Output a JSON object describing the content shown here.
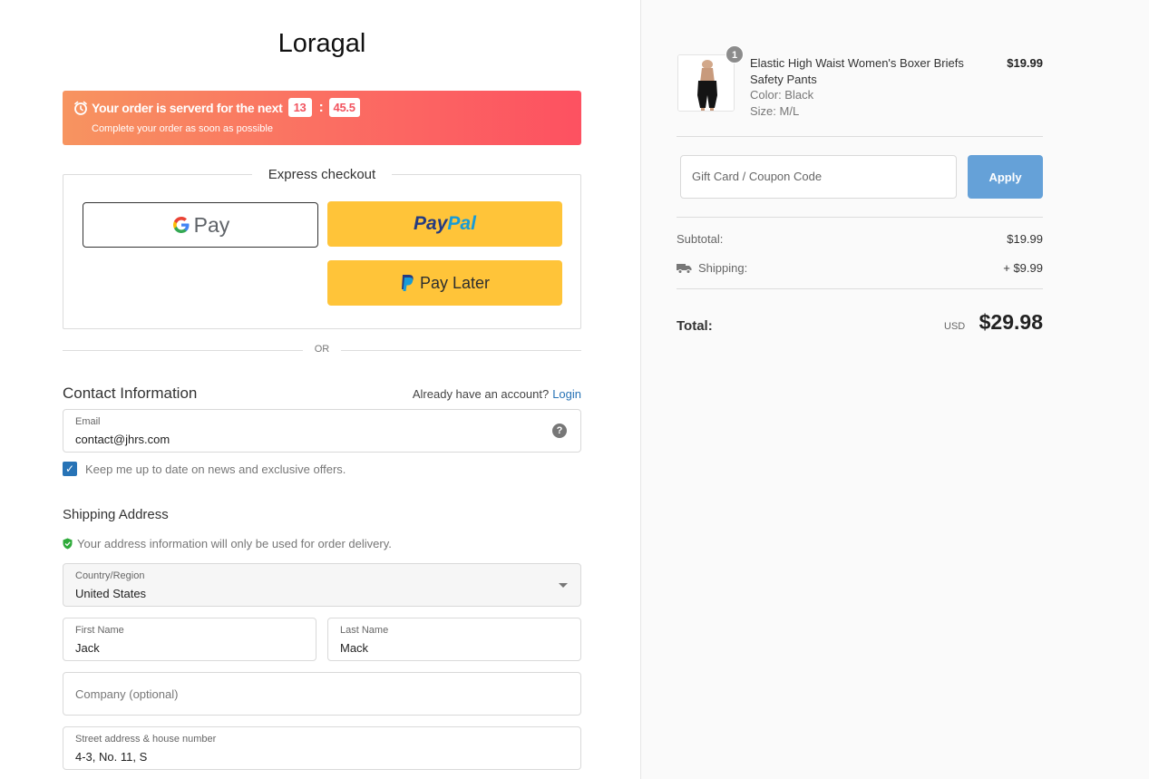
{
  "brand": "Loragal",
  "timer": {
    "message": "Your order is serverd for the next",
    "minutes": "13",
    "seconds": "45.5",
    "sub": "Complete your order as soon as possible"
  },
  "express": {
    "title": "Express checkout",
    "gpay_label": "Pay",
    "paypal_pay": "Pay",
    "paypal_pal": "Pal",
    "paylater_label": "Pay Later"
  },
  "or_text": "OR",
  "contact": {
    "heading": "Contact Information",
    "have_account": "Already have an account?",
    "login": "Login",
    "email_label": "Email",
    "email_value": "contact@jhrs.com",
    "newsletter_label": "Keep me up to date on news and exclusive offers.",
    "newsletter_checked": true
  },
  "shipping": {
    "heading": "Shipping Address",
    "note": "Your address information will only be used for order delivery.",
    "country_label": "Country/Region",
    "country_value": "United States",
    "first_name_label": "First Name",
    "first_name_value": "Jack",
    "last_name_label": "Last Name",
    "last_name_value": "Mack",
    "company_placeholder": "Company (optional)",
    "street_label": "Street address & house number",
    "street_value": "4-3, No. 11, S"
  },
  "summary": {
    "product": {
      "quantity": "1",
      "name": "Elastic High Waist Women's Boxer Briefs Safety Pants",
      "color": "Color: Black",
      "size": "Size: M/L",
      "price": "$19.99"
    },
    "coupon_placeholder": "Gift Card / Coupon Code",
    "apply_label": "Apply",
    "subtotal_label": "Subtotal:",
    "subtotal_value": "$19.99",
    "shipping_label": "Shipping:",
    "shipping_value": "+ $9.99",
    "total_label": "Total:",
    "currency": "USD",
    "total_value": "$29.98"
  },
  "colors": {
    "accent": "#2773b6",
    "apply_button": "#65a1d8",
    "timer_start": "#f79460",
    "timer_end": "#fd5161",
    "paypal_yellow": "#ffc439"
  }
}
